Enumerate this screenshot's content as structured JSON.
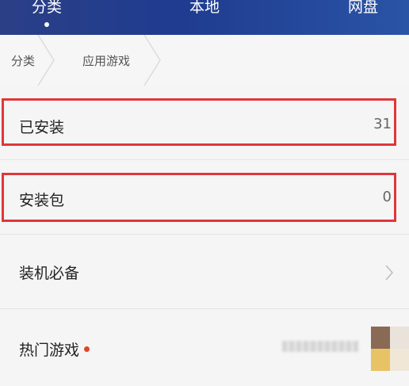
{
  "tabs": [
    {
      "label": "分类",
      "active": true
    },
    {
      "label": "本地",
      "active": false
    },
    {
      "label": "网盘",
      "active": false
    }
  ],
  "breadcrumb": [
    "分类",
    "应用游戏"
  ],
  "rows": {
    "installed": {
      "title": "已安装",
      "count": "31"
    },
    "packages": {
      "title": "安装包",
      "count": "0"
    },
    "essentials": {
      "title": "装机必备",
      "icon": "chevron-right-icon"
    },
    "hot_games": {
      "title": "热门游戏",
      "badge_color": "#e2432a"
    }
  },
  "colors": {
    "header_gradient_start": "#2b3f86",
    "header_gradient_end": "#2a54a6",
    "highlight": "#e0363a",
    "background": "#f5f5f5"
  }
}
